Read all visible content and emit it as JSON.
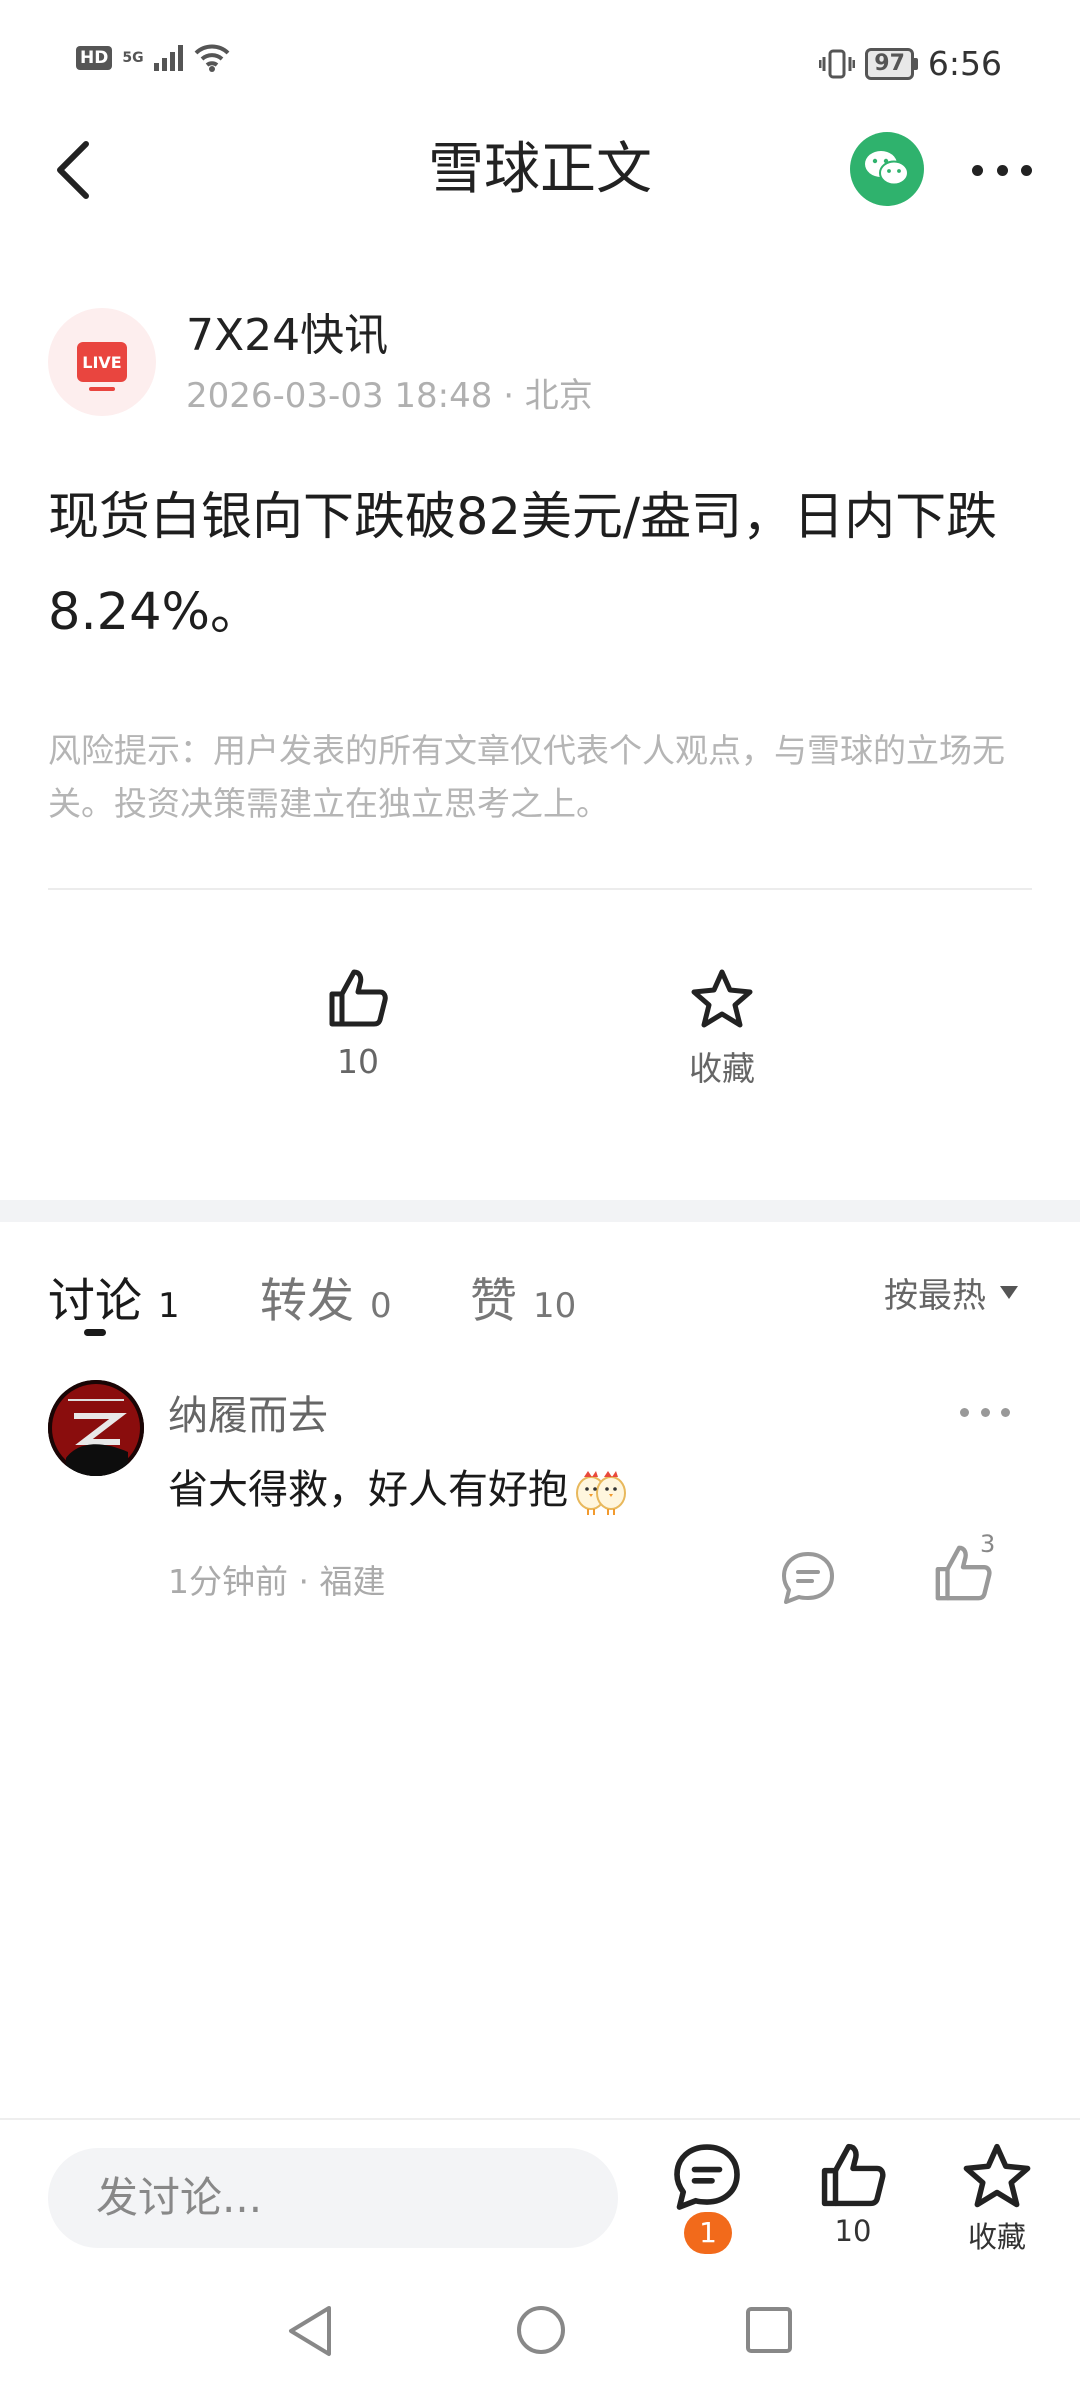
{
  "status_bar": {
    "hd": "HD",
    "network": "5G",
    "battery": "97",
    "time": "6:56"
  },
  "header": {
    "title": "雪球正文"
  },
  "post": {
    "author_name": "7X24快讯",
    "avatar_label": "LIVE",
    "meta": "2026-03-03 18:48 · 北京",
    "body": "现货白银向下跌破82美元/盎司，日内下跌8.24%。",
    "risk_notice": "风险提示：用户发表的所有文章仅代表个人观点，与雪球的立场无关。投资决策需建立在独立思考之上。",
    "like_count": "10",
    "favorite_label": "收藏"
  },
  "tabs": [
    {
      "label": "讨论",
      "count": "1",
      "active": true
    },
    {
      "label": "转发",
      "count": "0",
      "active": false
    },
    {
      "label": "赞",
      "count": "10",
      "active": false
    }
  ],
  "sort": {
    "label": "按最热"
  },
  "comments": [
    {
      "user": "纳履而去",
      "text": "省大得救，好人有好抱",
      "meta": "1分钟前 · 福建",
      "like_count": "3"
    }
  ],
  "bottom_bar": {
    "input_placeholder": "发讨论...",
    "comment_badge": "1",
    "like_count": "10",
    "favorite_label": "收藏"
  },
  "colors": {
    "accent_green": "#2fb26d",
    "badge_orange": "#f26a1b",
    "live_red": "#e9453f"
  }
}
